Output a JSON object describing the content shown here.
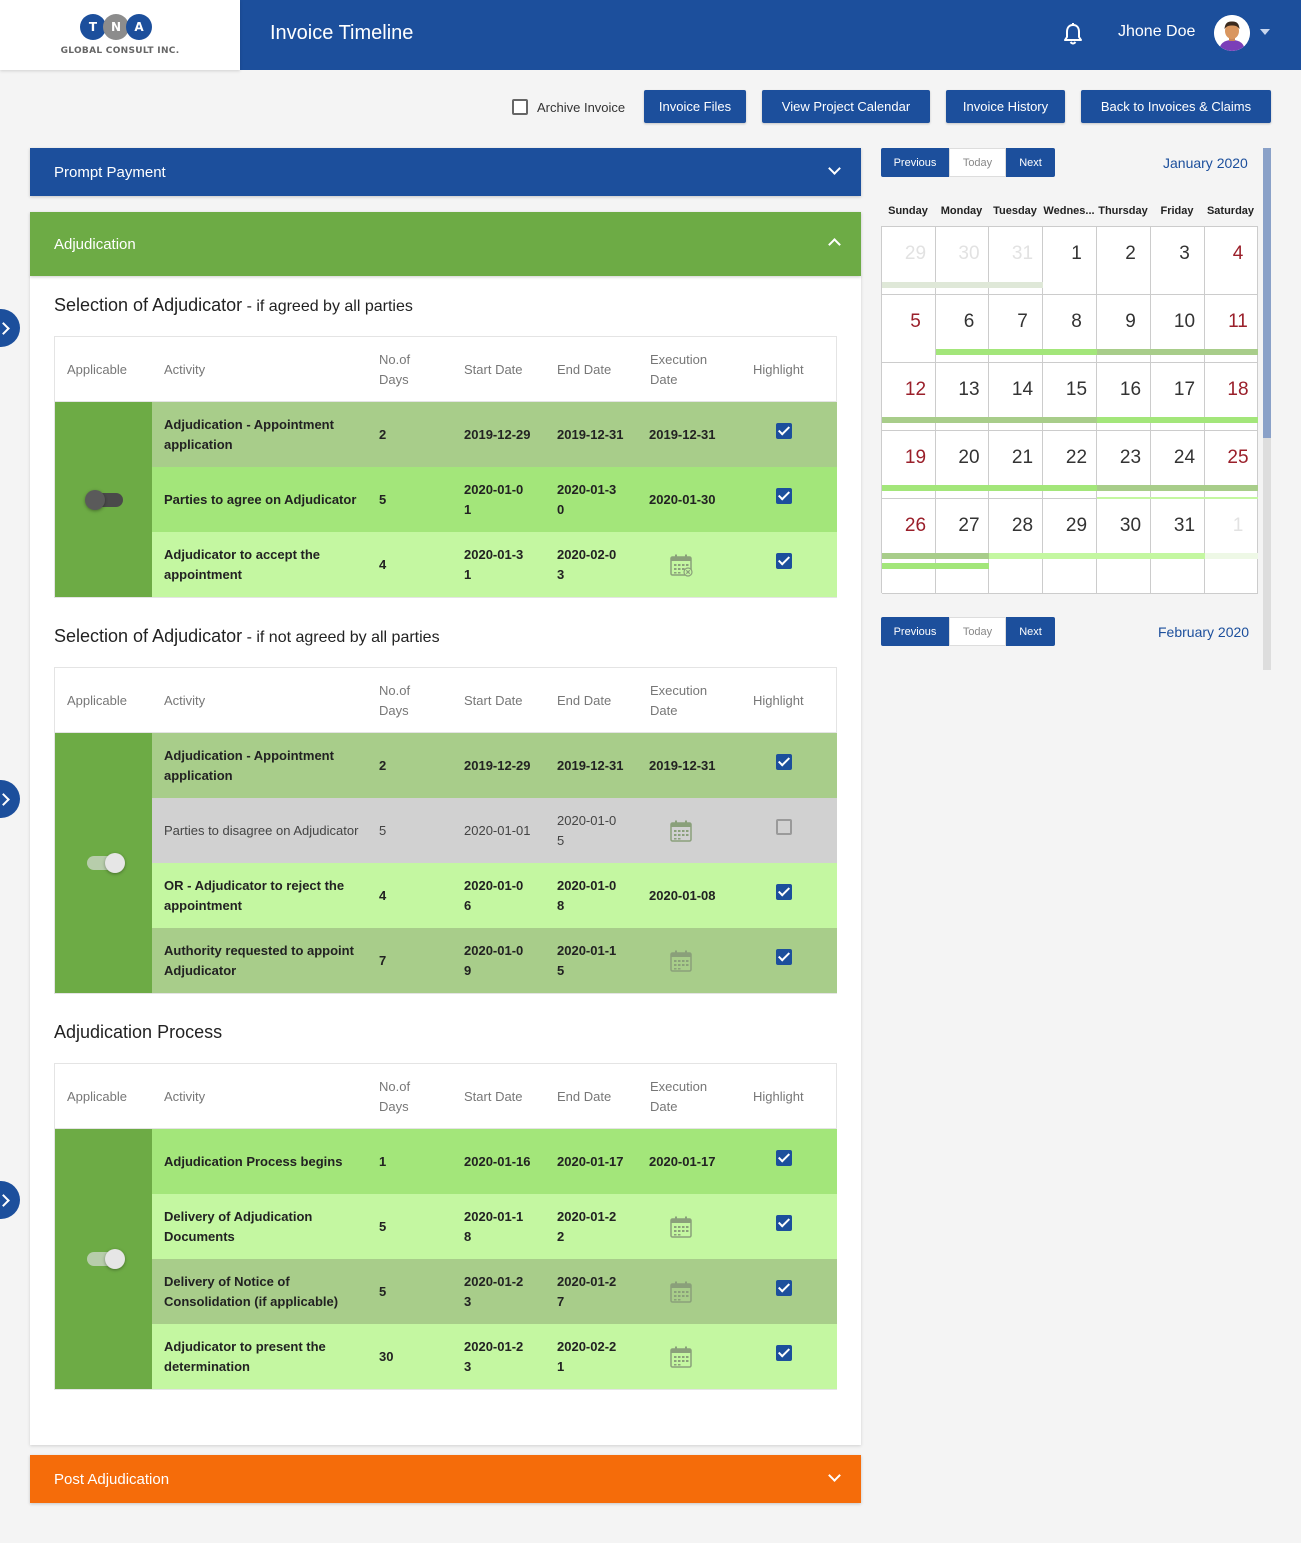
{
  "app": {
    "title": "Invoice Timeline",
    "logo_letters": [
      "T",
      "N",
      "A"
    ],
    "logo_subtitle": "GLOBAL CONSULT INC.",
    "user_name": "Jhone Doe"
  },
  "toolbar": {
    "archive_label": "Archive Invoice",
    "archive_checked": false,
    "buttons": [
      "Invoice Files",
      "View Project Calendar",
      "Invoice History",
      "Back to Invoices & Claims"
    ]
  },
  "accordions": {
    "prompt_payment": "Prompt Payment",
    "adjudication": "Adjudication",
    "post_adjudication": "Post Adjudication"
  },
  "colors": {
    "primary": "#1c4f9c",
    "adjudication_green": "#6dab45",
    "post_orange": "#f56c0a",
    "row_done_light": "#a8cd8a",
    "row_active": "#a3e67a",
    "row_pending": "#c4f7a1",
    "row_disabled": "#d1d1d1",
    "weekend_red": "#9a1f2a"
  },
  "table_headers": {
    "applicable": "Applicable",
    "activity": "Activity",
    "days_1": "No.of",
    "days_2": "Days",
    "start": "Start Date",
    "end": "End Date",
    "exec_1": "Execution",
    "exec_2": "Date",
    "highlight": "Highlight"
  },
  "sections": [
    {
      "title": "Selection of Adjudicator",
      "subtitle": " - if agreed by all parties",
      "toggle_on": false,
      "rows": [
        {
          "activity": "Adjudication - Appointment application",
          "days": "2",
          "start": "2019-12-29",
          "end": "2019-12-31",
          "execution": "2019-12-31",
          "exec_icon": "",
          "highlight": true,
          "tone": "row_done_light",
          "plain": false
        },
        {
          "activity": "Parties to agree on Adjudicator",
          "days": "5",
          "start": "2020-01-01",
          "end": "2020-01-30",
          "execution": "2020-01-30",
          "exec_icon": "",
          "highlight": true,
          "tone": "row_active",
          "plain": false
        },
        {
          "activity": "Adjudicator to accept the appointment",
          "days": "4",
          "start": "2020-01-31",
          "end": "2020-02-03",
          "execution": "",
          "exec_icon": "calendar-x-icon",
          "highlight": true,
          "tone": "row_pending",
          "plain": false
        }
      ]
    },
    {
      "title": "Selection of Adjudicator",
      "subtitle": " - if not agreed by all parties",
      "toggle_on": true,
      "rows": [
        {
          "activity": "Adjudication - Appointment application",
          "days": "2",
          "start": "2019-12-29",
          "end": "2019-12-31",
          "execution": "2019-12-31",
          "exec_icon": "",
          "highlight": true,
          "tone": "row_done_light",
          "plain": false
        },
        {
          "activity": "Parties to disagree on Adjudicator",
          "days": "5",
          "start": "2020-01-01",
          "end": "2020-01-05",
          "execution": "",
          "exec_icon": "calendar-icon",
          "highlight": false,
          "tone": "row_disabled",
          "plain": true
        },
        {
          "activity": "OR - Adjudicator to reject the appointment",
          "days": "4",
          "start": "2020-01-06",
          "end": "2020-01-08",
          "execution": "2020-01-08",
          "exec_icon": "",
          "highlight": true,
          "tone": "row_pending",
          "plain": false
        },
        {
          "activity": "Authority requested to appoint Adjudicator",
          "days": "7",
          "start": "2020-01-09",
          "end": "2020-01-15",
          "execution": "",
          "exec_icon": "calendar-icon",
          "highlight": true,
          "tone": "row_done_light",
          "plain": false
        }
      ]
    },
    {
      "title": "Adjudication Process",
      "subtitle": "",
      "toggle_on": true,
      "rows": [
        {
          "activity": "Adjudication Process begins",
          "days": "1",
          "start": "2020-01-16",
          "end": "2020-01-17",
          "execution": "2020-01-17",
          "exec_icon": "",
          "highlight": true,
          "tone": "row_active",
          "plain": false
        },
        {
          "activity": "Delivery of Adjudication Documents",
          "days": "5",
          "start": "2020-01-18",
          "end": "2020-01-22",
          "execution": "",
          "exec_icon": "calendar-icon",
          "highlight": true,
          "tone": "row_pending",
          "plain": false
        },
        {
          "activity": "Delivery of Notice of Consolidation (if applicable)",
          "days": "5",
          "start": "2020-01-23",
          "end": "2020-01-27",
          "execution": "",
          "exec_icon": "calendar-icon",
          "highlight": true,
          "tone": "row_done_light",
          "plain": false
        },
        {
          "activity": "Adjudicator to present the determination",
          "days": "30",
          "start": "2020-01-23",
          "end": "2020-02-21",
          "execution": "",
          "exec_icon": "calendar-icon",
          "highlight": true,
          "tone": "row_pending",
          "plain": false
        }
      ]
    }
  ],
  "calendar": {
    "nav": {
      "previous": "Previous",
      "today": "Today",
      "next": "Next"
    },
    "month_label": "January 2020",
    "next_month_label": "February 2020",
    "weekdays": [
      "Sunday",
      "Monday",
      "Tuesday",
      "Wednes...",
      "Thursday",
      "Friday",
      "Saturday"
    ],
    "weeks": [
      [
        "29",
        "30",
        "31",
        "1",
        "2",
        "3",
        "4"
      ],
      [
        "5",
        "6",
        "7",
        "8",
        "9",
        "10",
        "11"
      ],
      [
        "12",
        "13",
        "14",
        "15",
        "16",
        "17",
        "18"
      ],
      [
        "19",
        "20",
        "21",
        "22",
        "23",
        "24",
        "25"
      ],
      [
        "26",
        "27",
        "28",
        "29",
        "30",
        "31",
        "1"
      ]
    ],
    "muted_days": [
      [
        0,
        0
      ],
      [
        0,
        1
      ],
      [
        0,
        2
      ],
      [
        4,
        6
      ]
    ]
  }
}
